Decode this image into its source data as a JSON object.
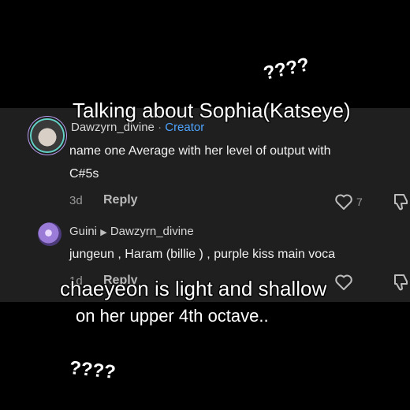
{
  "overlays": {
    "question_top": "????",
    "title": "Talking about Sophia(Katseye)",
    "caption_line1": "chaeyeon is light and shallow",
    "caption_line2": "on her upper 4th octave..",
    "question_bottom": "????"
  },
  "comment1": {
    "author": "Dawzyrn_divine",
    "separator": "·",
    "badge": "Creator",
    "line1": "name one Average with her level of output with",
    "line2": "C#5s",
    "age": "3d",
    "reply_label": "Reply",
    "like_count": "7"
  },
  "comment2": {
    "author": "Guini",
    "reply_to": "Dawzyrn_divine",
    "text": "jungeun , Haram (billie ) , purple kiss main voca",
    "age": "1d",
    "reply_label": "Reply"
  },
  "icons": {
    "like": "heart-outline-icon",
    "dislike": "thumbs-down-icon",
    "reply_arrow": "triangle-right-icon"
  }
}
